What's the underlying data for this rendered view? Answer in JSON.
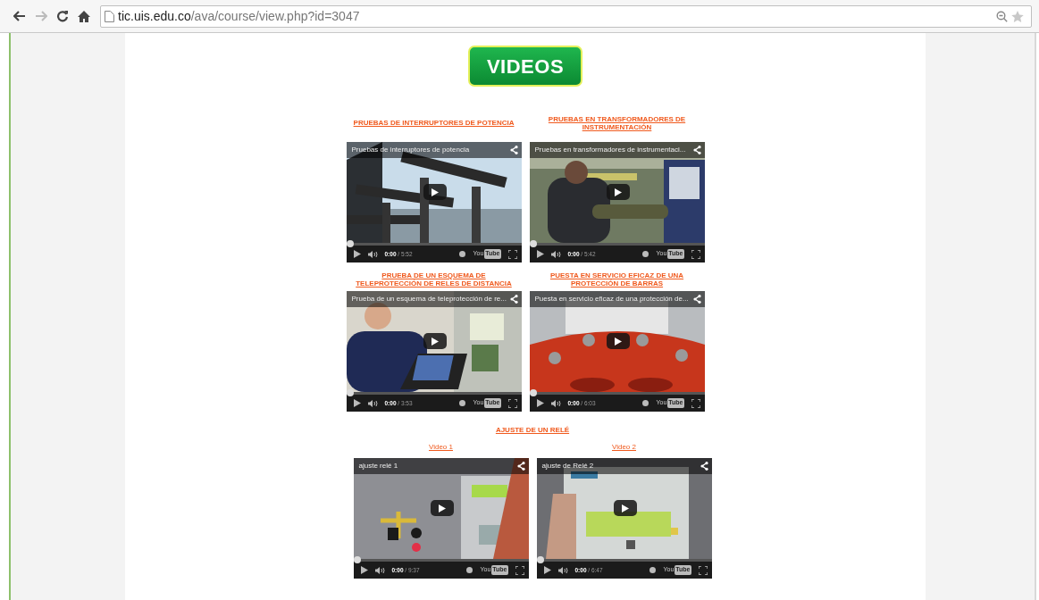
{
  "browser": {
    "url_host": "tic.uis.edu.co",
    "url_path": "/ava/course/view.php?id=3047"
  },
  "heading": "VIDEOS",
  "sections": [
    {
      "kind": "pair",
      "items": [
        {
          "link": "PRUEBAS DE INTERRUPTORES DE POTENCIA",
          "video": {
            "title": "Pruebas de interruptores de potencia",
            "time": "0:00",
            "duration": "/ 5:52",
            "level": 0,
            "logo_left": "You",
            "logo_boxed": "Tube"
          }
        },
        {
          "link": "PRUEBAS EN TRANSFORMADORES DE INSTRUMENTACIÓN",
          "video": {
            "title": "Pruebas en transformadores de instrumentaci...",
            "time": "0:00",
            "duration": "/ 5:42",
            "level": 0,
            "logo_left": "You",
            "logo_boxed": "Tube"
          }
        }
      ]
    },
    {
      "kind": "pair",
      "items": [
        {
          "link": "PRUEBA DE UN ESQUEMA DE TELEPROTECCIÓN DE RELES DE DISTANCIA",
          "video": {
            "title": "Prueba de un esquema de teleprotección de re...",
            "time": "0:00",
            "duration": "/ 3:53",
            "level": 0,
            "logo_left": "You",
            "logo_boxed": "Tube"
          }
        },
        {
          "link": "PUESTA EN SERVICIO EFICAZ DE UNA PROTECCIÓN DE BARRAS",
          "video": {
            "title": "Puesta en servicio eficaz de una protección de...",
            "time": "0:00",
            "duration": "/ 6:03",
            "level": 0,
            "logo_left": "You",
            "logo_boxed": "Tube"
          }
        }
      ]
    },
    {
      "kind": "titled",
      "title": "AJUSTE DE UN RELÉ",
      "items": [
        {
          "link": "Video 1",
          "video": {
            "title": "ajuste relé 1",
            "time": "0:00",
            "duration": "/ 9:37",
            "level": 0,
            "logo_left": "You",
            "logo_boxed": "Tube"
          }
        },
        {
          "link": "Video 2",
          "video": {
            "title": "ajuste de Relé 2",
            "time": "0:00",
            "duration": "/ 6:47",
            "level": 0,
            "logo_left": "You",
            "logo_boxed": "Tube"
          }
        }
      ]
    }
  ]
}
